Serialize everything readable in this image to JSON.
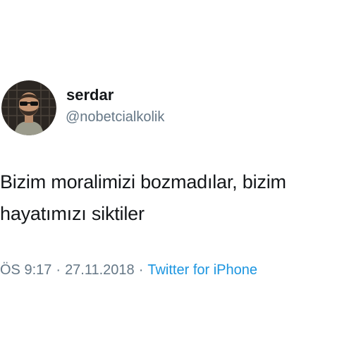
{
  "user": {
    "display_name": "serdar",
    "handle": "@nobetcialkolik"
  },
  "tweet": {
    "lines": [
      "Bizim moralimizi bozmadılar, bizim",
      "hayatımızı siktiler"
    ]
  },
  "meta": {
    "time": "ÖS 9:17",
    "separator": "·",
    "date": "27.11.2018",
    "source": "Twitter for iPhone"
  },
  "colors": {
    "text": "#14171a",
    "secondary": "#657786",
    "link": "#1b95e0"
  }
}
